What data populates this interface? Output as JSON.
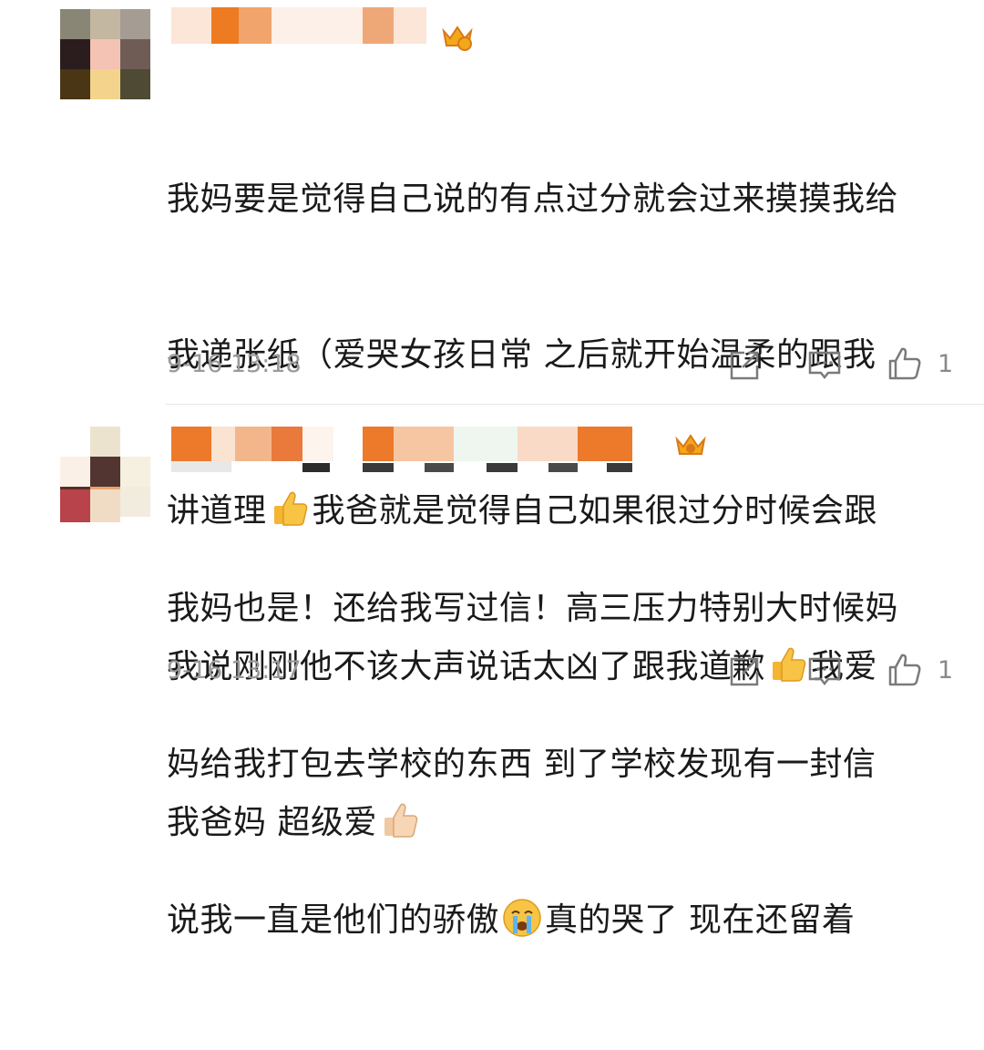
{
  "comments": [
    {
      "text_lines": [
        "我妈要是觉得自己说的有点过分就会过来摸摸我给",
        "我递张纸（爱哭女孩日常 之后就开始温柔的跟我",
        [
          "讲道理",
          "👍",
          "我爸就是觉得自己如果很过分时候会跟"
        ],
        [
          "我说刚刚他不该大声说话太凶了跟我道歉",
          "👍",
          "我爱"
        ],
        [
          "我爸妈 超级爱",
          "👍"
        ]
      ],
      "time": "9-16 13:18",
      "like_count": "1",
      "icons": [
        "repost-icon",
        "comment-icon",
        "like-icon"
      ]
    },
    {
      "text_lines": [
        "我妈也是！还给我写过信！高三压力特别大时候妈",
        "妈给我打包去学校的东西 到了学校发现有一封信",
        [
          "说我一直是他们的骄傲",
          "😭",
          "真的哭了 现在还留着"
        ]
      ],
      "time": "9-16 13:17",
      "like_count": "1",
      "icons": [
        "repost-icon",
        "comment-icon",
        "like-icon"
      ]
    }
  ],
  "colors": {
    "crown": "#f2a818",
    "crown_dark": "#d9781a",
    "icon": "#7a7a7a",
    "time": "#9a9a9a",
    "name_orange": "#ec7a2a"
  }
}
